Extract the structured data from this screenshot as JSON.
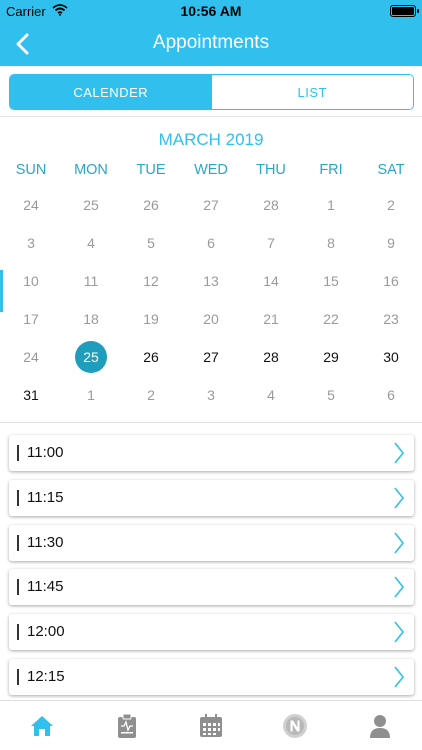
{
  "status_bar": {
    "carrier": "Carrier",
    "time": "10:56 AM"
  },
  "header": {
    "title": "Appointments",
    "back_icon": "chevron-left-icon"
  },
  "view_toggle": {
    "options": [
      "CALENDER",
      "LIST"
    ],
    "selected": "CALENDER"
  },
  "calendar": {
    "month_label": "MARCH 2019",
    "weekdays": [
      "SUN",
      "MON",
      "TUE",
      "WED",
      "THU",
      "FRI",
      "SAT"
    ],
    "weeks": [
      [
        "24",
        "25",
        "26",
        "27",
        "28",
        "1",
        "2"
      ],
      [
        "3",
        "4",
        "5",
        "6",
        "7",
        "8",
        "9"
      ],
      [
        "10",
        "11",
        "12",
        "13",
        "14",
        "15",
        "16"
      ],
      [
        "17",
        "18",
        "19",
        "20",
        "21",
        "22",
        "23"
      ],
      [
        "24",
        "25",
        "26",
        "27",
        "28",
        "29",
        "30"
      ],
      [
        "31",
        "1",
        "2",
        "3",
        "4",
        "5",
        "6"
      ]
    ],
    "selected_day": "25"
  },
  "time_slots": [
    "11:00",
    "11:15",
    "11:30",
    "11:45",
    "12:00",
    "12:15"
  ],
  "tab_bar": {
    "tabs": [
      "home-icon",
      "clipboard-icon",
      "calendar-icon",
      "n-logo-icon",
      "profile-icon"
    ],
    "active": "home-icon"
  },
  "colors": {
    "accent": "#31c0ee",
    "selected_day": "#1e9dbd",
    "inactive_icon": "#8f8f8f"
  }
}
